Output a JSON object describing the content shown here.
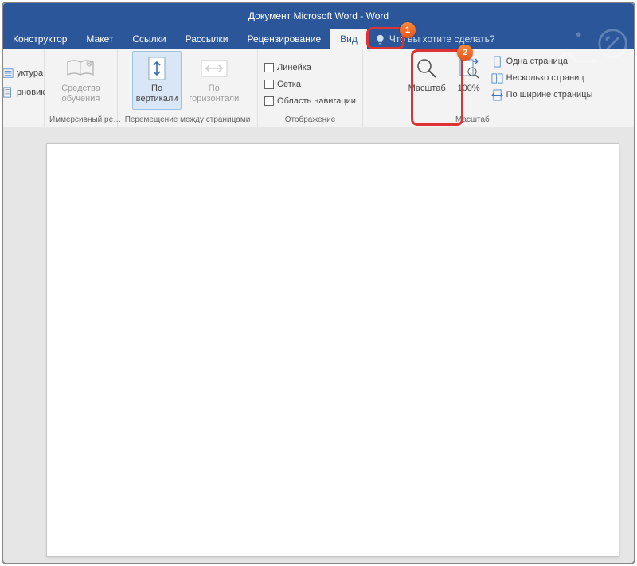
{
  "title": "Документ Microsoft Word  -  Word",
  "tabs": {
    "konstructor": "Конструктор",
    "maket": "Макет",
    "ssylki": "Ссылки",
    "rassylki": "Рассылки",
    "recenz": "Рецензирование",
    "vid": "Вид"
  },
  "tellme": "Что вы хотите сделать?",
  "views": {
    "struktura": "уктура",
    "chernovik": "рновик",
    "grouplabel": "…"
  },
  "immersive": {
    "sredstva1": "Средства",
    "sredstva2": "обучения",
    "grouplabel": "Иммерсивный ре…"
  },
  "pagemove": {
    "vert1": "По",
    "vert2": "вертикали",
    "horiz1": "По",
    "horiz2": "горизонтали",
    "grouplabel": "Перемещение между страницами"
  },
  "display": {
    "lineyka": "Линейка",
    "setka": "Сетка",
    "navpane": "Область навигации",
    "grouplabel": "Отображение"
  },
  "zoom": {
    "zoomlabel": "Масштаб",
    "hundred": "100%",
    "onepage": "Одна страница",
    "multipage": "Несколько страниц",
    "pagewidth": "По ширине страницы",
    "grouplabel": "Масштаб"
  },
  "badges": {
    "one": "1",
    "two": "2"
  }
}
